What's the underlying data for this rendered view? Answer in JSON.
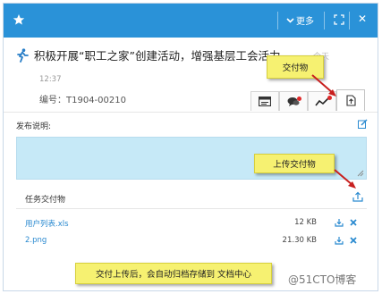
{
  "header": {
    "more_label": "更多",
    "colors": {
      "bar": "#2a92d8"
    }
  },
  "task": {
    "title": "积极开展“职工之家”创建活动，增强基层工会活力",
    "title_tail": "今天",
    "time": "12:37",
    "code": "编号：T1904-00210"
  },
  "tabs": [
    {
      "icon": "card-icon"
    },
    {
      "icon": "chat-icon",
      "badge": true
    },
    {
      "icon": "trend-icon",
      "badge": true
    },
    {
      "icon": "upload-file-icon",
      "active": true
    }
  ],
  "description": {
    "label": "发布说明:",
    "value": ""
  },
  "deliverables": {
    "label": "任务交付物",
    "files": [
      {
        "name": "用户列表.xls",
        "size": "12 KB"
      },
      {
        "name": "2.png",
        "size": "21.30 KB"
      }
    ]
  },
  "callouts": {
    "tab": "交付物",
    "upload": "上传交付物",
    "archive": "交付上传后，会自动归档存储到 文档中心"
  },
  "watermark": "@51CTO博客"
}
